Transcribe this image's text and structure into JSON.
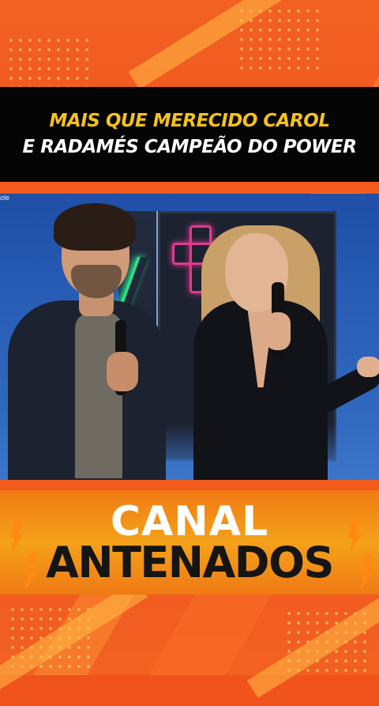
{
  "headline": {
    "line1": "MAIS QUE MERECIDO CAROL",
    "line2": "E RADAMÉS CAMPEÃO DO POWER"
  },
  "video": {
    "watermark": "ole"
  },
  "logo": {
    "line1": "CANAL",
    "line2": "ANTENADOS"
  },
  "colors": {
    "frame": "#f0531c",
    "headline_highlight": "#f6c21a",
    "headline_text": "#ffffff",
    "headline_bg": "#050505",
    "logo_band": "#f4a21a"
  }
}
